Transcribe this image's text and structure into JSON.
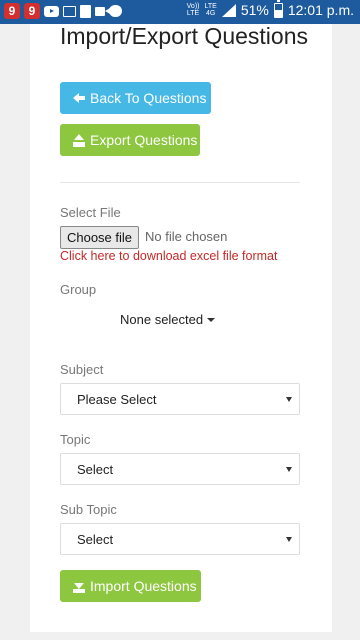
{
  "status_bar": {
    "app_badges": [
      "9",
      "9"
    ],
    "network_top": "Vo))",
    "network_bottom": "LTE",
    "lte_label": "LTE",
    "lte_sub": "4G",
    "battery_text": "51%",
    "battery_level": 0.51,
    "time": "12:01 p.m."
  },
  "page": {
    "title": "Import/Export Questions",
    "back_button": "Back To Questions",
    "export_button": "Export Questions",
    "import_button": "Import Questions"
  },
  "file": {
    "label": "Select File",
    "choose_button": "Choose file",
    "status": "No file chosen",
    "download_link": "Click here to download excel file format"
  },
  "group": {
    "label": "Group",
    "selected": "None selected"
  },
  "subject": {
    "label": "Subject",
    "value": "Please Select"
  },
  "topic": {
    "label": "Topic",
    "value": "Select"
  },
  "sub_topic": {
    "label": "Sub Topic",
    "value": "Select"
  },
  "colors": {
    "info": "#46b8e6",
    "success": "#8dc63f",
    "link": "#c62828",
    "status_bar": "#1d5a9e"
  }
}
